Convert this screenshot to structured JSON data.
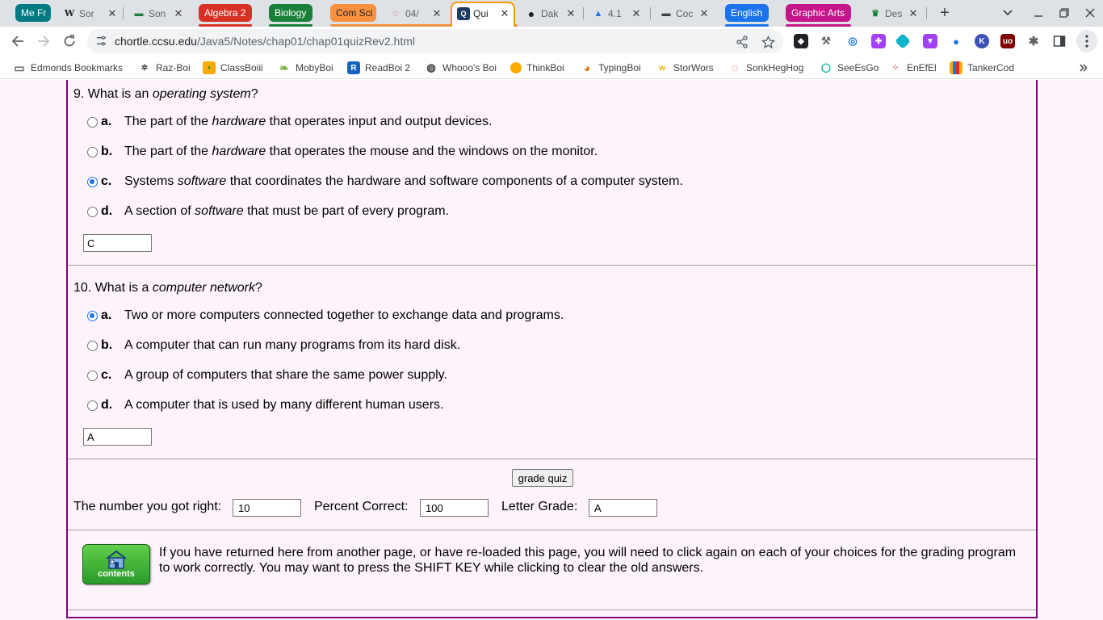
{
  "tabs": {
    "groups": [
      {
        "label": "Me Fr",
        "color": "#007b83"
      },
      {
        "label": "Algebra 2",
        "color": "#d93025"
      },
      {
        "label": "Biology",
        "color": "#188038"
      },
      {
        "label": "Com Sci",
        "color": "#fa903e"
      },
      {
        "label": "English",
        "color": "#1a73e8"
      },
      {
        "label": "Graphic Arts",
        "color": "#c5158a"
      }
    ],
    "items": [
      {
        "title": "Sor",
        "icon": "W"
      },
      {
        "title": "Son",
        "icon": "▬"
      },
      {
        "title": "04/",
        "icon": "◌"
      },
      {
        "title": "Qui",
        "icon": "Q"
      },
      {
        "title": "Dak",
        "icon": "●"
      },
      {
        "title": "4.1",
        "icon": "▲"
      },
      {
        "title": "Coc",
        "icon": "▬"
      },
      {
        "title": "Des",
        "icon": "♛"
      }
    ],
    "close_glyph": "✕",
    "new_tab_glyph": "+"
  },
  "toolbar": {
    "url_host": "chortle.ccsu.edu",
    "url_path": "/Java5/Notes/chap01/chap01quizRev2.html"
  },
  "bookmarks": [
    {
      "label": "Edmonds Bookmarks",
      "icon": "folder-icon"
    },
    {
      "label": "Raz-Boi",
      "icon": "raz-icon"
    },
    {
      "label": "ClassBoiii",
      "icon": "classroom-icon"
    },
    {
      "label": "MobyBoi",
      "icon": "moby-icon"
    },
    {
      "label": "ReadBoi 2",
      "icon": "readworks-icon"
    },
    {
      "label": "Whooo's Boi",
      "icon": "globe-icon"
    },
    {
      "label": "ThinkBoi",
      "icon": "thinkcentral-icon"
    },
    {
      "label": "TypingBoi",
      "icon": "typing-icon"
    },
    {
      "label": "StorWors",
      "icon": "storyworks-icon"
    },
    {
      "label": "SonkHegHog",
      "icon": "sonic-icon"
    },
    {
      "label": "SeeEsGo",
      "icon": "seesaw-icon"
    },
    {
      "label": "EnEfEl",
      "icon": "nfl-icon"
    },
    {
      "label": "TankerCod",
      "icon": "tanker-icon"
    }
  ],
  "questions": [
    {
      "number": "9.",
      "prefix": "What is an",
      "term": "operating system",
      "suffix": "?",
      "options": [
        {
          "letter": "a.",
          "pre": "The part of the",
          "em": "hardware",
          "post": "that operates input and output devices.",
          "selected": false
        },
        {
          "letter": "b.",
          "pre": "The part of the",
          "em": "hardware",
          "post": "that operates the mouse and the windows on the monitor.",
          "selected": false
        },
        {
          "letter": "c.",
          "pre": "Systems",
          "em": "software",
          "post": "that coordinates the hardware and software components of a computer system.",
          "selected": true
        },
        {
          "letter": "d.",
          "pre": "A section of",
          "em": "software",
          "post": "that must be part of every program.",
          "selected": false
        }
      ],
      "answer": "C"
    },
    {
      "number": "10.",
      "prefix": "What is a",
      "term": "computer network",
      "suffix": "?",
      "options": [
        {
          "letter": "a.",
          "pre": "Two or more computers connected together to exchange data and programs.",
          "em": "",
          "post": "",
          "selected": true
        },
        {
          "letter": "b.",
          "pre": "A computer that can run many programs from its hard disk.",
          "em": "",
          "post": "",
          "selected": false
        },
        {
          "letter": "c.",
          "pre": "A group of computers that share the same power supply.",
          "em": "",
          "post": "",
          "selected": false
        },
        {
          "letter": "d.",
          "pre": "A computer that is used by many different human users.",
          "em": "",
          "post": "",
          "selected": false
        }
      ],
      "answer": "A"
    }
  ],
  "grading": {
    "button_label": "grade quiz",
    "right_label": "The number you got right:",
    "right_value": "10",
    "percent_label": "Percent Correct:",
    "percent_value": "100",
    "letter_label": "Letter Grade:",
    "letter_value": "A"
  },
  "footer": {
    "contents_label": "contents",
    "notice": "If you have returned here from another page, or have re-loaded this page, you will need to click again on each of your choices for the grading program to work correctly. You may want to press the SHIFT KEY while clicking to clear the old answers."
  }
}
